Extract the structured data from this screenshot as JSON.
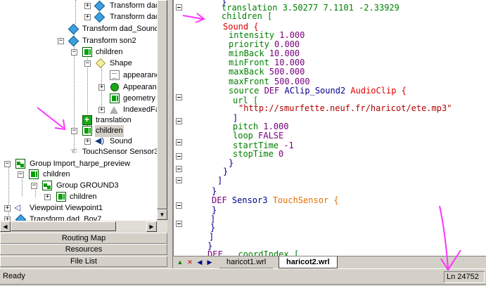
{
  "tree": {
    "rows": [
      {
        "label": "Transform dad",
        "icon": "transform-icon"
      },
      {
        "label": "Transform dad",
        "icon": "transform-icon"
      },
      {
        "label": "Transform dad_Sound",
        "icon": "transform-icon"
      },
      {
        "label": "Transform son2",
        "icon": "transform-icon"
      },
      {
        "label": "children",
        "icon": "children-icon"
      },
      {
        "label": "Shape",
        "icon": "shape-icon"
      },
      {
        "label": "appearance",
        "icon": "appearance-field-icon"
      },
      {
        "label": "Appearance",
        "icon": "appearance-icon"
      },
      {
        "label": "geometry",
        "icon": "geometry-icon"
      },
      {
        "label": "IndexedFa",
        "icon": "indexedfaceset-icon"
      },
      {
        "label": "translation",
        "icon": "translation-icon"
      },
      {
        "label": "children",
        "icon": "children-icon"
      },
      {
        "label": "Sound",
        "icon": "sound-icon"
      },
      {
        "label": "TouchSensor Sensor3",
        "icon": "touchsensor-icon"
      },
      {
        "label": "Group Import_harpe_preview",
        "icon": "group-icon"
      },
      {
        "label": "children",
        "icon": "children-icon"
      },
      {
        "label": "Group GROUND3",
        "icon": "group-icon"
      },
      {
        "label": "children",
        "icon": "children-icon"
      },
      {
        "label": "Viewpoint Viewpoint1",
        "icon": "viewpoint-icon"
      },
      {
        "label": "Transform dad_Boy7",
        "icon": "transform-icon"
      }
    ]
  },
  "panel_tabs": {
    "routing_map": "Routing Map",
    "resources": "Resources",
    "file_list": "File List"
  },
  "editor": {
    "lines": [
      {
        "segments": [
          {
            "t": "}",
            "c": "kw-b"
          }
        ]
      },
      {
        "segments": [
          {
            "t": "translation 3.50277 7.1101 -2.33929",
            "c": "kw-g"
          }
        ]
      },
      {
        "segments": [
          {
            "t": "children [",
            "c": "kw-g"
          }
        ]
      },
      {
        "segments": [
          {
            "t": "Sound {",
            "c": "kw-r"
          }
        ]
      },
      {
        "segments": [
          {
            "t": "intensity ",
            "c": "kw-g"
          },
          {
            "t": "1.000",
            "c": "kw-p"
          }
        ]
      },
      {
        "segments": [
          {
            "t": "priority ",
            "c": "kw-g"
          },
          {
            "t": "0.000",
            "c": "kw-p"
          }
        ]
      },
      {
        "segments": [
          {
            "t": "minBack ",
            "c": "kw-g"
          },
          {
            "t": "10.000",
            "c": "kw-p"
          }
        ]
      },
      {
        "segments": [
          {
            "t": "minFront ",
            "c": "kw-g"
          },
          {
            "t": "10.000",
            "c": "kw-p"
          }
        ]
      },
      {
        "segments": [
          {
            "t": "maxBack ",
            "c": "kw-g"
          },
          {
            "t": "500.000",
            "c": "kw-p"
          }
        ]
      },
      {
        "segments": [
          {
            "t": "maxFront ",
            "c": "kw-g"
          },
          {
            "t": "500.000",
            "c": "kw-p"
          }
        ]
      },
      {
        "segments": [
          {
            "t": "source ",
            "c": "kw-g"
          },
          {
            "t": "DEF ",
            "c": "kw-p"
          },
          {
            "t": "AClip_Sound2 ",
            "c": "kw-b"
          },
          {
            "t": "AudioClip {",
            "c": "kw-r"
          }
        ]
      },
      {
        "segments": [
          {
            "t": "url [",
            "c": "kw-g"
          }
        ]
      },
      {
        "segments": [
          {
            "t": "\"http://smurfette.neuf.fr/haricot/ete.mp3\"",
            "c": "kw-m"
          }
        ]
      },
      {
        "segments": [
          {
            "t": "]",
            "c": "kw-b"
          }
        ]
      },
      {
        "segments": [
          {
            "t": "pitch ",
            "c": "kw-g"
          },
          {
            "t": "1.000",
            "c": "kw-p"
          }
        ]
      },
      {
        "segments": [
          {
            "t": "loop ",
            "c": "kw-g"
          },
          {
            "t": "FALSE",
            "c": "kw-p"
          }
        ]
      },
      {
        "segments": [
          {
            "t": "startTime ",
            "c": "kw-g"
          },
          {
            "t": "-1",
            "c": "kw-p"
          }
        ]
      },
      {
        "segments": [
          {
            "t": "stopTime ",
            "c": "kw-g"
          },
          {
            "t": "0",
            "c": "kw-p"
          }
        ]
      },
      {
        "segments": [
          {
            "t": "}",
            "c": "kw-b"
          }
        ]
      },
      {
        "segments": [
          {
            "t": "}",
            "c": "kw-b"
          }
        ]
      },
      {
        "segments": [
          {
            "t": "]",
            "c": "kw-b"
          }
        ]
      },
      {
        "segments": [
          {
            "t": "}",
            "c": "kw-b"
          }
        ]
      },
      {
        "segments": [
          {
            "t": "DEF ",
            "c": "kw-p"
          },
          {
            "t": "Sensor3 ",
            "c": "kw-b"
          },
          {
            "t": "TouchSensor {",
            "c": "kw-o"
          }
        ]
      },
      {
        "segments": [
          {
            "t": "}",
            "c": "kw-b"
          }
        ]
      },
      {
        "segments": [
          {
            "t": "]",
            "c": "kw-b"
          }
        ]
      },
      {
        "segments": [
          {
            "t": "}",
            "c": "kw-b"
          }
        ]
      },
      {
        "segments": [
          {
            "t": "]",
            "c": "kw-b"
          }
        ]
      },
      {
        "segments": [
          {
            "t": "}",
            "c": "kw-b"
          }
        ]
      },
      {
        "segments": [
          {
            "t": "DEF ",
            "c": "kw-p"
          },
          {
            "t": "  coordIndex [",
            "c": "kw-g"
          }
        ]
      }
    ]
  },
  "tabs": {
    "file1": "haricot1.wrl",
    "file2": "haricot2.wrl"
  },
  "status": {
    "text": "Ready",
    "line": "Ln 24752"
  },
  "colors": {
    "annotation": "#ff33ff"
  }
}
